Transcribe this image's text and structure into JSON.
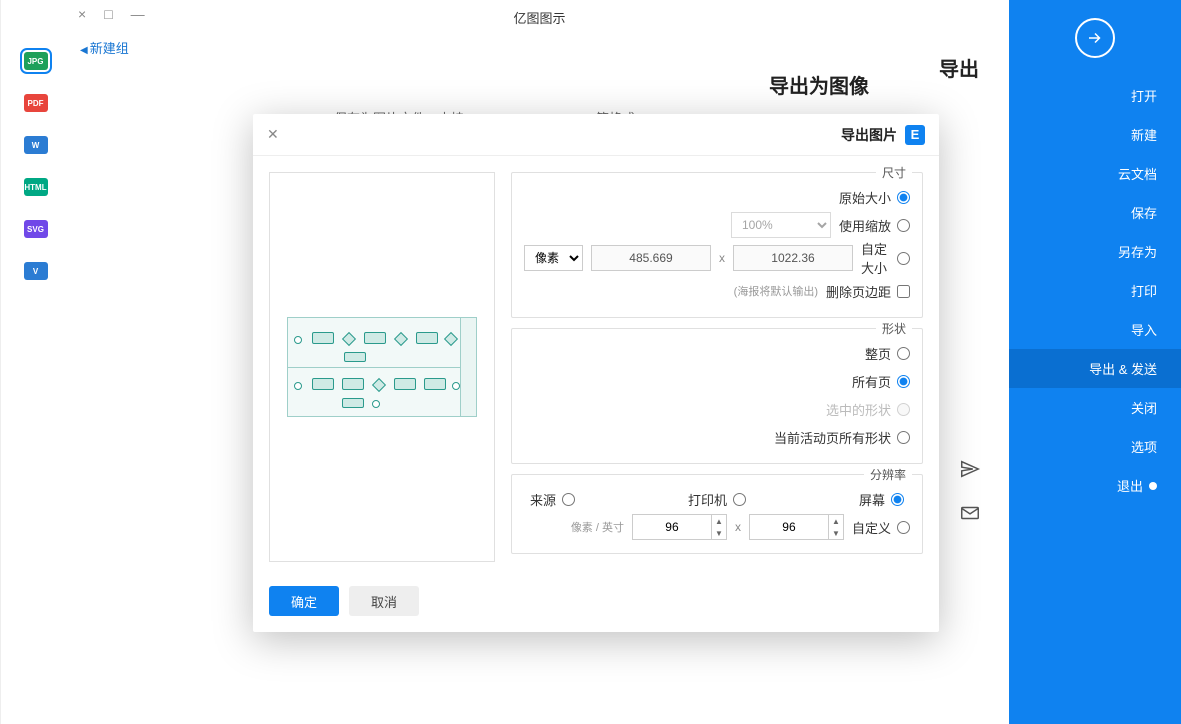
{
  "window": {
    "title": "亿图图示"
  },
  "home_link": "新建组",
  "sidebar": {
    "items": [
      {
        "label": "打开"
      },
      {
        "label": "新建"
      },
      {
        "label": "云文档"
      },
      {
        "label": "保存"
      },
      {
        "label": "另存为"
      },
      {
        "label": "打印"
      },
      {
        "label": "导入"
      },
      {
        "label": "导出 & 发送"
      },
      {
        "label": "关闭"
      },
      {
        "label": "选项"
      },
      {
        "label": "退出"
      }
    ],
    "active_index": 7
  },
  "export": {
    "heading": "导出",
    "sub_heading": "导出为图像",
    "sub_desc": "保存为图片文件，支持BMP, JPEG, PNG, GIF等格式",
    "formats": [
      {
        "code": "JPG",
        "cls": "jpg"
      },
      {
        "code": "PDF",
        "cls": "pdf"
      },
      {
        "code": "W",
        "cls": "doc"
      },
      {
        "code": "HTML",
        "cls": "html"
      },
      {
        "code": "SVG",
        "cls": "svg"
      },
      {
        "code": "V",
        "cls": "vsd"
      }
    ],
    "active_format": 0
  },
  "side_icons": {
    "send": "发送",
    "mail": "邮件"
  },
  "modal": {
    "title": "导出图片",
    "close": "✕",
    "size": {
      "legend": "尺寸",
      "original": "原始大小",
      "zoom": "使用缩放",
      "zoom_val": "100%",
      "custom": "自定大小",
      "w": "1022.36",
      "h": "485.669",
      "unit_label": "像素",
      "delete_margin": "删除页边距",
      "delete_hint": "(海报将默认输出)"
    },
    "shape": {
      "legend": "形状",
      "full": "整页",
      "all": "所有页",
      "selected": "选中的形状",
      "visible": "当前活动页所有形状"
    },
    "res": {
      "legend": "分辨率",
      "screen": "屏幕",
      "print": "打印机",
      "source": "来源",
      "custom": "自定义",
      "dpi1": "96",
      "dpi2": "96",
      "unit": "像素 / 英寸"
    },
    "ok": "确定",
    "cancel": "取消"
  }
}
